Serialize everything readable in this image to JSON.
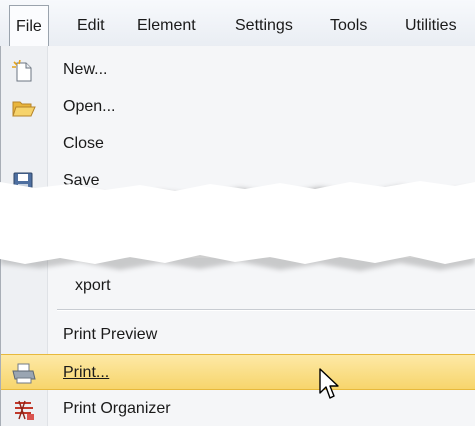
{
  "menubar": {
    "items": [
      {
        "label": "File",
        "active": true
      },
      {
        "label": "Edit"
      },
      {
        "label": "Element"
      },
      {
        "label": "Settings"
      },
      {
        "label": "Tools"
      },
      {
        "label": "Utilities"
      }
    ]
  },
  "file_menu": {
    "new_label": "New...",
    "open_label": "Open...",
    "close_label": "Close",
    "save_label": "Save",
    "export_label": "xport",
    "print_preview_label": "Print Preview",
    "print_label": "Print...",
    "print_organizer_label": "Print Organizer",
    "highlight_color": "#f7d56c"
  }
}
